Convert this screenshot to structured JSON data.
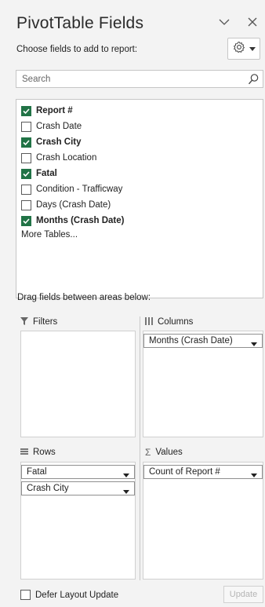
{
  "header": {
    "title": "PivotTable Fields",
    "subtitle": "Choose fields to add to report:"
  },
  "search": {
    "placeholder": "Search"
  },
  "fields": [
    {
      "label": "Report #",
      "checked": true
    },
    {
      "label": "Crash Date",
      "checked": false
    },
    {
      "label": "Crash City",
      "checked": true
    },
    {
      "label": "Crash Location",
      "checked": false
    },
    {
      "label": "Fatal",
      "checked": true
    },
    {
      "label": "Condition - Trafficway",
      "checked": false
    },
    {
      "label": "Days (Crash Date)",
      "checked": false
    },
    {
      "label": "Months (Crash Date)",
      "checked": true
    }
  ],
  "more_tables": "More Tables...",
  "drag_label": "Drag fields between areas below:",
  "areas": {
    "filters": {
      "label": "Filters",
      "items": []
    },
    "columns": {
      "label": "Columns",
      "items": [
        "Months (Crash Date)"
      ]
    },
    "rows": {
      "label": "Rows",
      "items": [
        "Fatal",
        "Crash City"
      ]
    },
    "values": {
      "label": "Values",
      "items": [
        "Count of Report #"
      ]
    }
  },
  "footer": {
    "defer_label": "Defer Layout Update",
    "defer_checked": false,
    "update_label": "Update"
  },
  "colors": {
    "accent": "#217346"
  }
}
